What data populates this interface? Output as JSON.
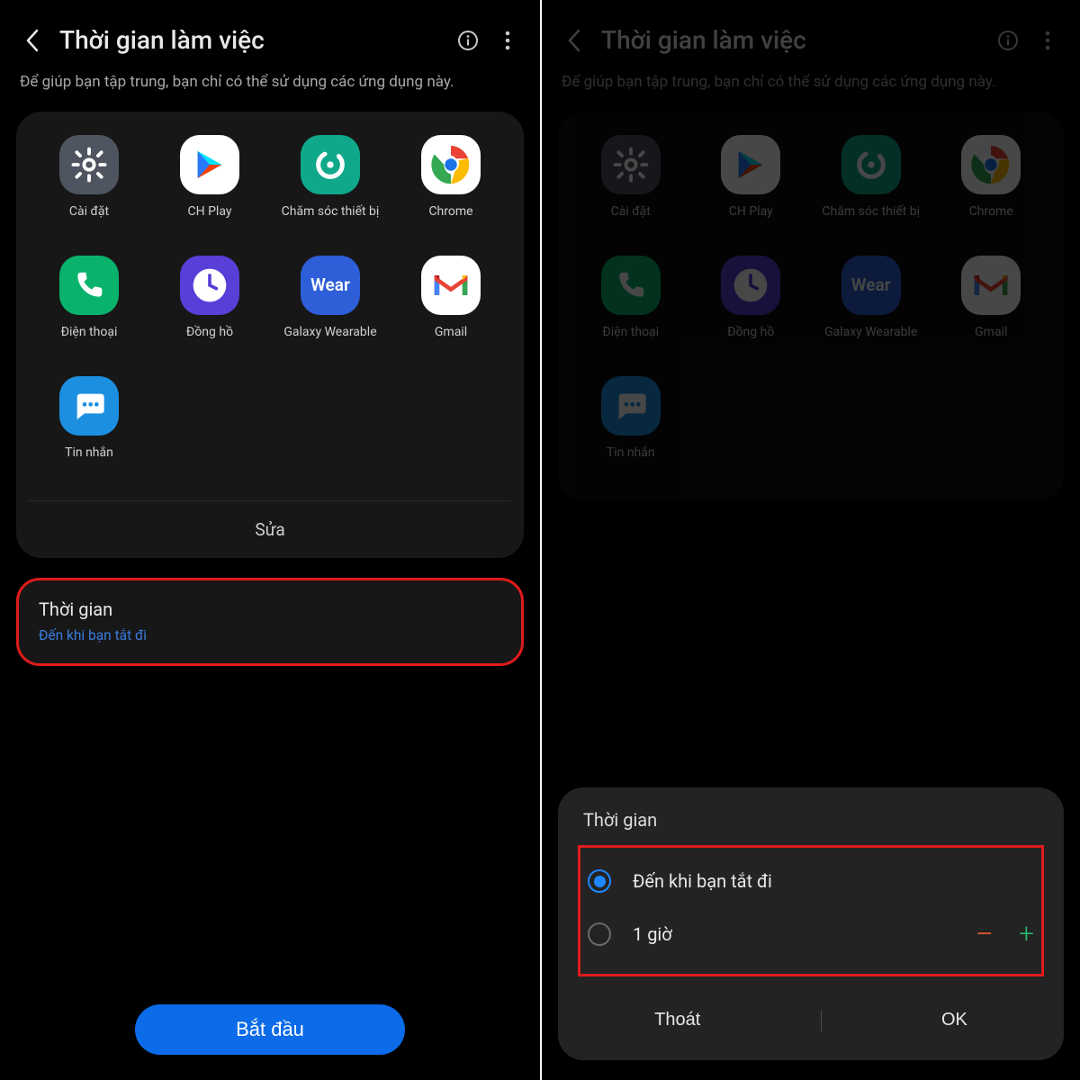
{
  "left": {
    "header": {
      "title": "Thời gian làm việc"
    },
    "subtitle": "Để giúp bạn tập trung, bạn chỉ có thể sử dụng các ứng dụng này.",
    "apps": [
      {
        "name": "Cài đặt",
        "icon": "settings",
        "bg": "#4f5560"
      },
      {
        "name": "CH Play",
        "icon": "play",
        "bg": "#ffffff"
      },
      {
        "name": "Chăm sóc thiết bị",
        "icon": "devicecare",
        "bg": "#0fa88a"
      },
      {
        "name": "Chrome",
        "icon": "chrome",
        "bg": "#ffffff"
      },
      {
        "name": "Điện thoại",
        "icon": "phone",
        "bg": "#0ab36b"
      },
      {
        "name": "Đồng hồ",
        "icon": "clock",
        "bg": "#5a3ed8"
      },
      {
        "name": "Galaxy Wearable",
        "icon": "wear",
        "bg": "#2e5ed8"
      },
      {
        "name": "Gmail",
        "icon": "gmail",
        "bg": "#ffffff"
      },
      {
        "name": "Tin nhắn",
        "icon": "messages",
        "bg": "#1d8fe0"
      }
    ],
    "edit_label": "Sửa",
    "time_card": {
      "title": "Thời gian",
      "subtitle": "Đến khi bạn tắt đi"
    },
    "start_label": "Bắt đầu"
  },
  "right": {
    "header": {
      "title": "Thời gian làm việc"
    },
    "subtitle": "Để giúp bạn tập trung, bạn chỉ có thể sử dụng các ứng dụng này.",
    "dialog": {
      "title": "Thời gian",
      "options": [
        {
          "label": "Đến khi bạn tắt đi",
          "selected": true
        },
        {
          "label": "1 giờ",
          "selected": false
        }
      ],
      "cancel": "Thoát",
      "ok": "OK"
    }
  },
  "colors": {
    "accent": "#0b6be8",
    "link": "#3b7ce0",
    "highlight_red": "#e11b1b",
    "highlight_orange": "#e07a1b"
  }
}
